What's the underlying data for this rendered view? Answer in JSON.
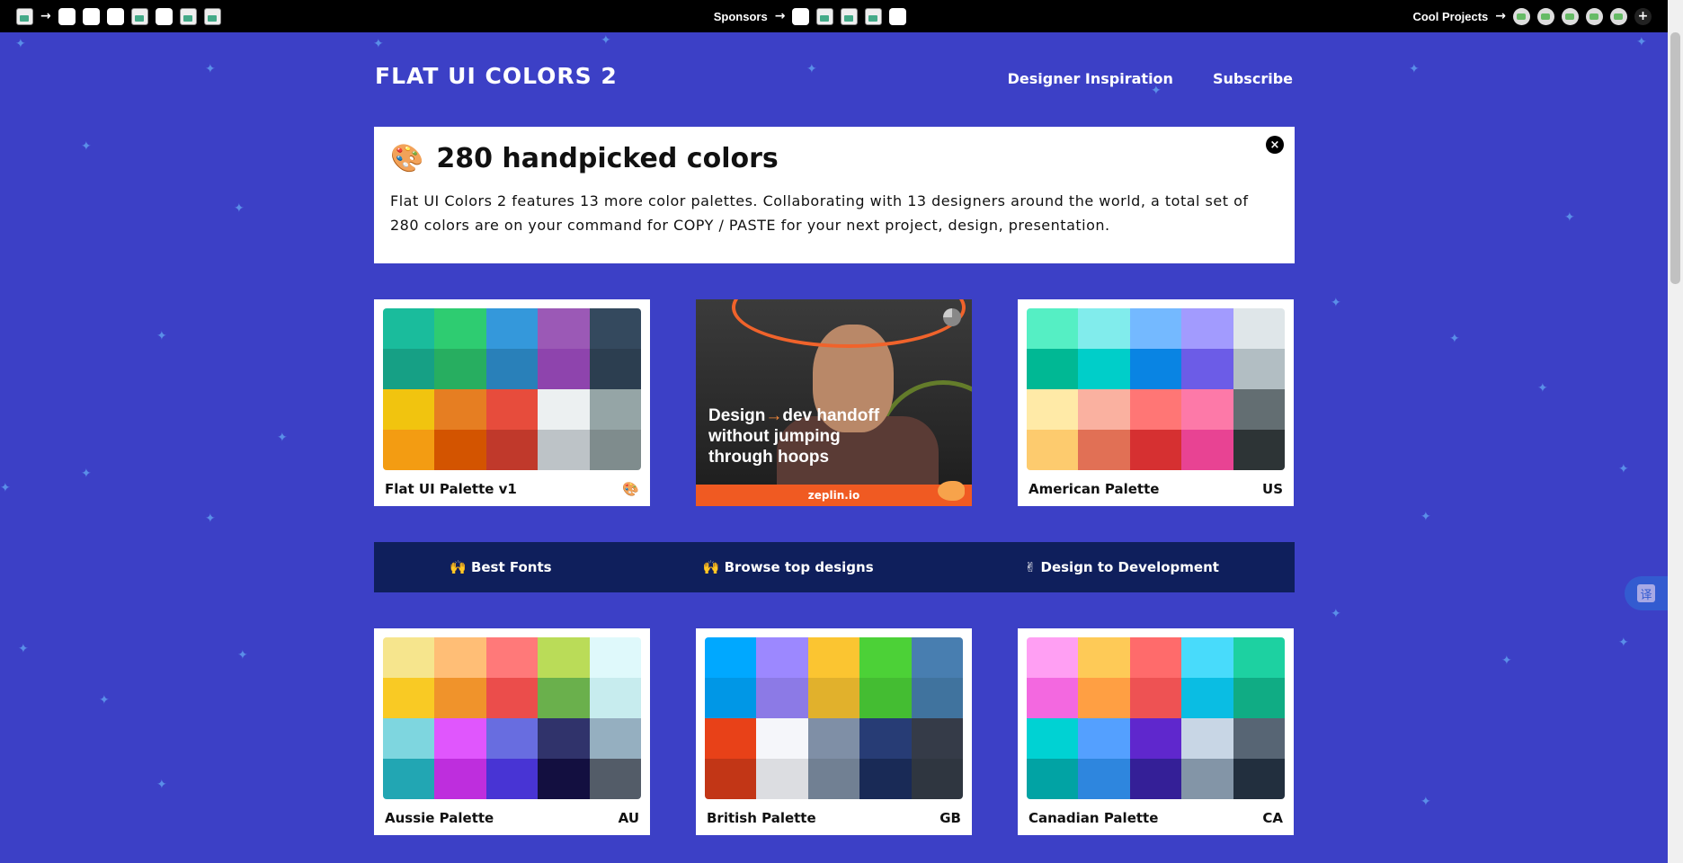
{
  "topbar": {
    "sponsors_label": "Sponsors",
    "cool_projects_label": "Cool Projects",
    "add_label": "+"
  },
  "header": {
    "brand": "FLAT UI COLORS 2",
    "nav": [
      "Designer Inspiration",
      "Subscribe"
    ]
  },
  "intro": {
    "emoji": "🎨",
    "title": "280 handpicked colors",
    "body": "Flat UI Colors 2 features 13 more color palettes. Collaborating with 13 designers around the world, a total set of 280 colors are on your command for COPY / PASTE for your next project, design, presentation.",
    "close": "×"
  },
  "palettes": [
    {
      "name": "Flat UI Palette v1",
      "code": "🎨",
      "colors": [
        "#1abc9c",
        "#2ecc71",
        "#3498db",
        "#9b59b6",
        "#34495e",
        "#16a085",
        "#27ae60",
        "#2980b9",
        "#8e44ad",
        "#2c3e50",
        "#f1c40f",
        "#e67e22",
        "#e74c3c",
        "#ecf0f1",
        "#95a5a6",
        "#f39c12",
        "#d35400",
        "#c0392b",
        "#bdc3c7",
        "#7f8c8d"
      ]
    },
    {
      "name": "American Palette",
      "code": "US",
      "colors": [
        "#55efc4",
        "#81ecec",
        "#74b9ff",
        "#a29bfe",
        "#dfe6e9",
        "#00b894",
        "#00cec9",
        "#0984e3",
        "#6c5ce7",
        "#b2bec3",
        "#ffeaa7",
        "#fab1a0",
        "#ff7675",
        "#fd79a8",
        "#636e72",
        "#fdcb6e",
        "#e17055",
        "#d63031",
        "#e84393",
        "#2d3436"
      ]
    },
    {
      "name": "Aussie Palette",
      "code": "AU",
      "colors": [
        "#f6e58d",
        "#ffbe76",
        "#ff7979",
        "#badc58",
        "#dff9fb",
        "#f9ca24",
        "#f0932b",
        "#eb4d4b",
        "#6ab04c",
        "#c7ecee",
        "#7ed6df",
        "#e056fd",
        "#686de0",
        "#30336b",
        "#95afc0",
        "#22a6b3",
        "#be2edd",
        "#4834d4",
        "#130f40",
        "#535c68"
      ]
    },
    {
      "name": "British Palette",
      "code": "GB",
      "colors": [
        "#00a8ff",
        "#9c88ff",
        "#fbc531",
        "#4cd137",
        "#487eb0",
        "#0097e6",
        "#8c7ae6",
        "#e1b12c",
        "#44bd32",
        "#40739e",
        "#e84118",
        "#f5f6fa",
        "#7f8fa6",
        "#273c75",
        "#353b48",
        "#c23616",
        "#dcdde1",
        "#718093",
        "#192a56",
        "#2f3640"
      ]
    },
    {
      "name": "Canadian Palette",
      "code": "CA",
      "colors": [
        "#ff9ff3",
        "#feca57",
        "#ff6b6b",
        "#48dbfb",
        "#1dd1a1",
        "#f368e0",
        "#ff9f43",
        "#ee5253",
        "#0abde3",
        "#10ac84",
        "#00d2d3",
        "#54a0ff",
        "#5f27cd",
        "#c8d6e5",
        "#576574",
        "#01a3a4",
        "#2e86de",
        "#341f97",
        "#8395a7",
        "#222f3e"
      ]
    }
  ],
  "ad": {
    "line1_a": "Design",
    "arrow": "→",
    "line1_b": "dev handoff",
    "line2": "without jumping",
    "line3": "through hoops",
    "site": "zeplin.io"
  },
  "links": [
    {
      "emoji": "🙌",
      "label": "Best Fonts"
    },
    {
      "emoji": "🙌",
      "label": "Browse top designs"
    },
    {
      "emoji": "✌",
      "label": "Design to Development"
    }
  ],
  "translate_glyph": "译"
}
